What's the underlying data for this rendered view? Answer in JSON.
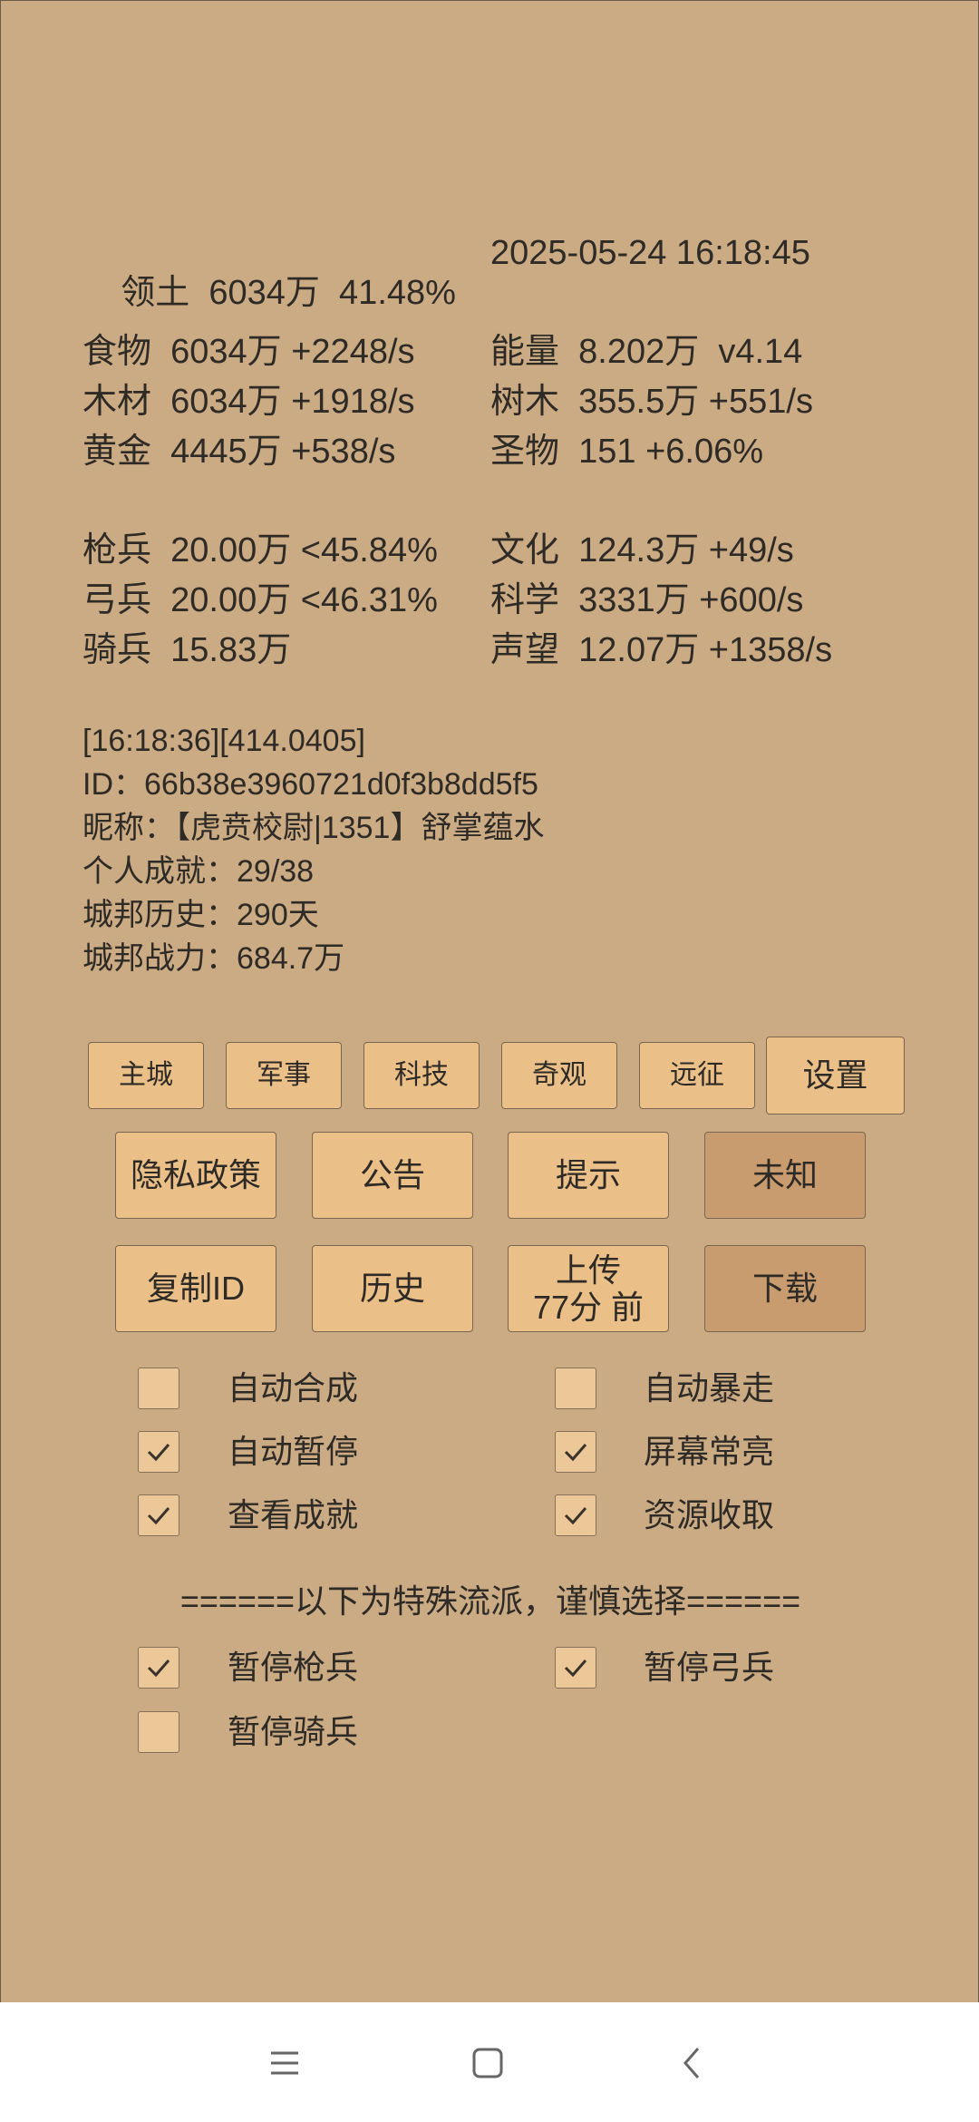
{
  "status": {
    "territory": {
      "label": "领土",
      "value": "6034万",
      "pct": "41.48%"
    },
    "datetime": "2025-05-24 16:18:45"
  },
  "resources_left": [
    {
      "label": "食物",
      "value": "6034万 +2248/s"
    },
    {
      "label": "木材",
      "value": "6034万 +1918/s"
    },
    {
      "label": "黄金",
      "value": "4445万 +538/s"
    }
  ],
  "resources_right": [
    {
      "label": "能量",
      "value": "8.202万  v4.14"
    },
    {
      "label": "树木",
      "value": "355.5万 +551/s"
    },
    {
      "label": "圣物",
      "value": "151 +6.06%"
    }
  ],
  "army_left": [
    {
      "label": "枪兵",
      "value": "20.00万 <45.84%"
    },
    {
      "label": "弓兵",
      "value": "20.00万 <46.31%"
    },
    {
      "label": "骑兵",
      "value": "15.83万"
    }
  ],
  "army_right": [
    {
      "label": "文化",
      "value": "124.3万 +49/s"
    },
    {
      "label": "科学",
      "value": "3331万 +600/s"
    },
    {
      "label": "声望",
      "value": "12.07万 +1358/s"
    }
  ],
  "info": {
    "log": "[16:18:36][414.0405]",
    "id": "ID：66b38e3960721d0f3b8dd5f5",
    "nickname": "昵称：【虎贲校尉|1351】舒掌蕴水",
    "achievements": "个人成就：29/38",
    "history": "城邦历史：290天",
    "power": "城邦战力：684.7万"
  },
  "tabs": [
    "主城",
    "军事",
    "科技",
    "奇观",
    "远征",
    "设置"
  ],
  "buttons_row1": [
    "隐私政策",
    "公告",
    "提示",
    "未知"
  ],
  "buttons_row2": {
    "copy_id": "复制ID",
    "history": "历史",
    "upload_line1": "上传",
    "upload_line2": "77分 前",
    "download": "下载"
  },
  "options": [
    {
      "label": "自动合成",
      "checked": false
    },
    {
      "label": "自动暴走",
      "checked": false
    },
    {
      "label": "自动暂停",
      "checked": true
    },
    {
      "label": "屏幕常亮",
      "checked": true
    },
    {
      "label": "查看成就",
      "checked": true
    },
    {
      "label": "资源收取",
      "checked": true
    }
  ],
  "separator": "======以下为特殊流派，谨慎选择======",
  "special_options": [
    {
      "label": "暂停枪兵",
      "checked": true
    },
    {
      "label": "暂停弓兵",
      "checked": true
    },
    {
      "label": "暂停骑兵",
      "checked": false
    }
  ],
  "navbar_icons": [
    "menu-icon",
    "home-icon",
    "back-icon"
  ]
}
